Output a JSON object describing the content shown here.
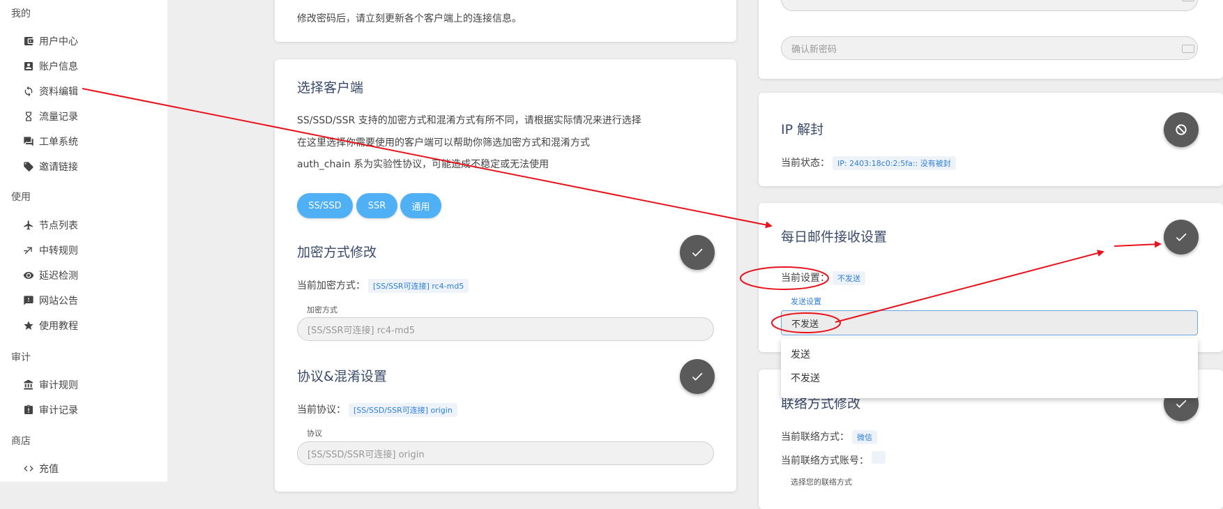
{
  "sidebar": {
    "groups": {
      "mine": "我的",
      "use": "使用",
      "audit": "审计",
      "shop": "商店"
    },
    "items": {
      "user_center": {
        "label": "用户中心",
        "icon": "wallet-icon"
      },
      "account_info": {
        "label": "账户信息",
        "icon": "account-box-icon"
      },
      "profile_edit": {
        "label": "资料编辑",
        "icon": "sync-icon"
      },
      "traffic_log": {
        "label": "流量记录",
        "icon": "hourglass-icon"
      },
      "ticket_system": {
        "label": "工单系统",
        "icon": "chat-icon"
      },
      "invite_link": {
        "label": "邀请链接",
        "icon": "tag-icon"
      },
      "node_list": {
        "label": "节点列表",
        "icon": "airplane-icon"
      },
      "relay_rules": {
        "label": "中转规则",
        "icon": "relay-icon"
      },
      "latency_check": {
        "label": "延迟检测",
        "icon": "eye-icon"
      },
      "announcements": {
        "label": "网站公告",
        "icon": "alert-icon"
      },
      "tutorial": {
        "label": "使用教程",
        "icon": "star-icon"
      },
      "audit_rules": {
        "label": "审计规则",
        "icon": "bank-icon"
      },
      "audit_log": {
        "label": "审计记录",
        "icon": "clipboard-alert-icon"
      },
      "recharge": {
        "label": "充值",
        "icon": "code-icon"
      }
    }
  },
  "password_card": {
    "notice": "修改密码后，请立刻更新各个客户端上的连接信息。"
  },
  "client_card": {
    "title": "选择客户端",
    "desc1": "SS/SSD/SSR 支持的加密方式和混淆方式有所不同，请根据实际情况来进行选择",
    "desc2": "在这里选择你需要使用的客户端可以帮助你筛选加密方式和混淆方式",
    "desc3": "auth_chain 系为实验性协议，可能造成不稳定或无法使用",
    "buttons": [
      "SS/SSD",
      "SSR",
      "通用"
    ],
    "encryption": {
      "title": "加密方式修改",
      "current_label": "当前加密方式：",
      "current_value": "[SS/SSR可连接] rc4-md5",
      "field_label": "加密方式",
      "field_value": "[SS/SSR可连接] rc4-md5"
    },
    "protocol": {
      "title": "协议&混淆设置",
      "current_label": "当前协议：",
      "current_value": "[SS/SSD/SSR可连接] origin",
      "field_label": "协议",
      "field_value": "[SS/SSD/SSR可连接] origin"
    }
  },
  "new_password_card": {
    "confirm_placeholder": "确认新密码"
  },
  "ip_card": {
    "title": "IP 解封",
    "status_label": "当前状态：",
    "status_value": "IP: 2403:18c0:2:5fa:: 没有被封"
  },
  "mail_card": {
    "title": "每日邮件接收设置",
    "current_label": "当前设置：",
    "current_value": "不发送",
    "field_label": "发送设置",
    "selected": "不发送",
    "options": [
      "发送",
      "不发送"
    ]
  },
  "contact_card": {
    "title": "联络方式修改",
    "method_label": "当前联络方式：",
    "method_value": "微信",
    "account_label": "当前联络方式账号：",
    "account_value": "",
    "select_hint": "选择您的联络方式"
  },
  "colors": {
    "accent": "#4fb0f5",
    "fab": "#5a5a5a",
    "annotation": "#e8121c",
    "badge_text": "#2f7fd8"
  }
}
